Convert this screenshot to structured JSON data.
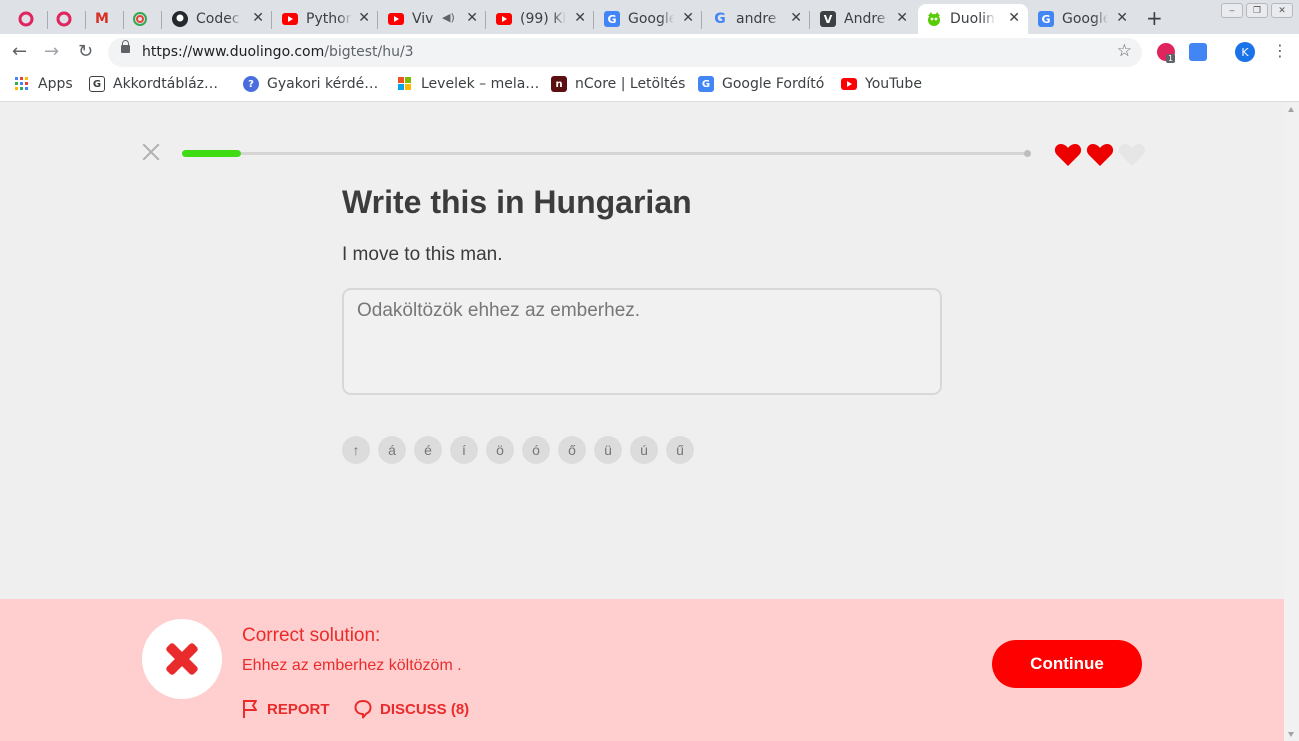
{
  "browser": {
    "tabs": [
      {
        "label": "",
        "icon": "opera-icon",
        "color": "#e0245e"
      },
      {
        "label": "",
        "icon": "opera-icon",
        "color": "#e0245e"
      },
      {
        "label": "",
        "icon": "gmail-icon",
        "color": "#d93025"
      },
      {
        "label": "",
        "icon": "spiral-icon",
        "color": "#34a853"
      },
      {
        "label": "Codec",
        "icon": "github-icon",
        "color": "#24292e"
      },
      {
        "label": "Python",
        "icon": "youtube-icon",
        "color": "#ff0000"
      },
      {
        "label": "Viv",
        "icon": "youtube-icon",
        "color": "#ff0000"
      },
      {
        "label": "(99) Kh",
        "icon": "youtube-icon",
        "color": "#ff0000"
      },
      {
        "label": "Google",
        "icon": "translate-icon",
        "color": "#4285f4"
      },
      {
        "label": "andre",
        "icon": "google-icon",
        "color": "#4285f4"
      },
      {
        "label": "Andre",
        "icon": "v-icon",
        "color": "#3c4043"
      },
      {
        "label": "Duolin",
        "icon": "duolingo-icon",
        "color": "#58cc02"
      },
      {
        "label": "Google",
        "icon": "translate-icon",
        "color": "#4285f4"
      }
    ],
    "url_host": "https://www.duolingo.com",
    "url_path": "/bigtest/hu/3",
    "profile_initial": "K",
    "ext_badge": "1"
  },
  "bookmarks": [
    {
      "label": "Apps",
      "icon": "apps-grid-icon"
    },
    {
      "label": "Akkordtábláz…",
      "icon": "g-icon"
    },
    {
      "label": "Gyakori kérdé…",
      "icon": "help-icon"
    },
    {
      "label": "Levelek – mela…",
      "icon": "windows-icon"
    },
    {
      "label": "nCore | Letöltés",
      "icon": "ncore-icon"
    },
    {
      "label": "Google Fordító",
      "icon": "translate-icon"
    },
    {
      "label": "YouTube",
      "icon": "youtube-icon"
    }
  ],
  "lesson": {
    "progress": 0.07,
    "hearts_total": 3,
    "hearts_remaining": 2,
    "challenge_title": "Write this in Hungarian",
    "prompt_sentence": "I move to this man.",
    "answer_value": "Odaköltözök ehhez az emberhez.",
    "special_keys": [
      "↑",
      "á",
      "é",
      "í",
      "ö",
      "ó",
      "ő",
      "ü",
      "ú",
      "ű"
    ]
  },
  "feedback": {
    "heading": "Correct solution:",
    "solution": "Ehhez az emberhez költözöm .",
    "report_label": "REPORT",
    "discuss_label": "DISCUSS (8)",
    "continue_label": "Continue",
    "colors": {
      "error": "#ea2b2b",
      "background": "#ffcfcf",
      "button": "#ff0000"
    }
  }
}
